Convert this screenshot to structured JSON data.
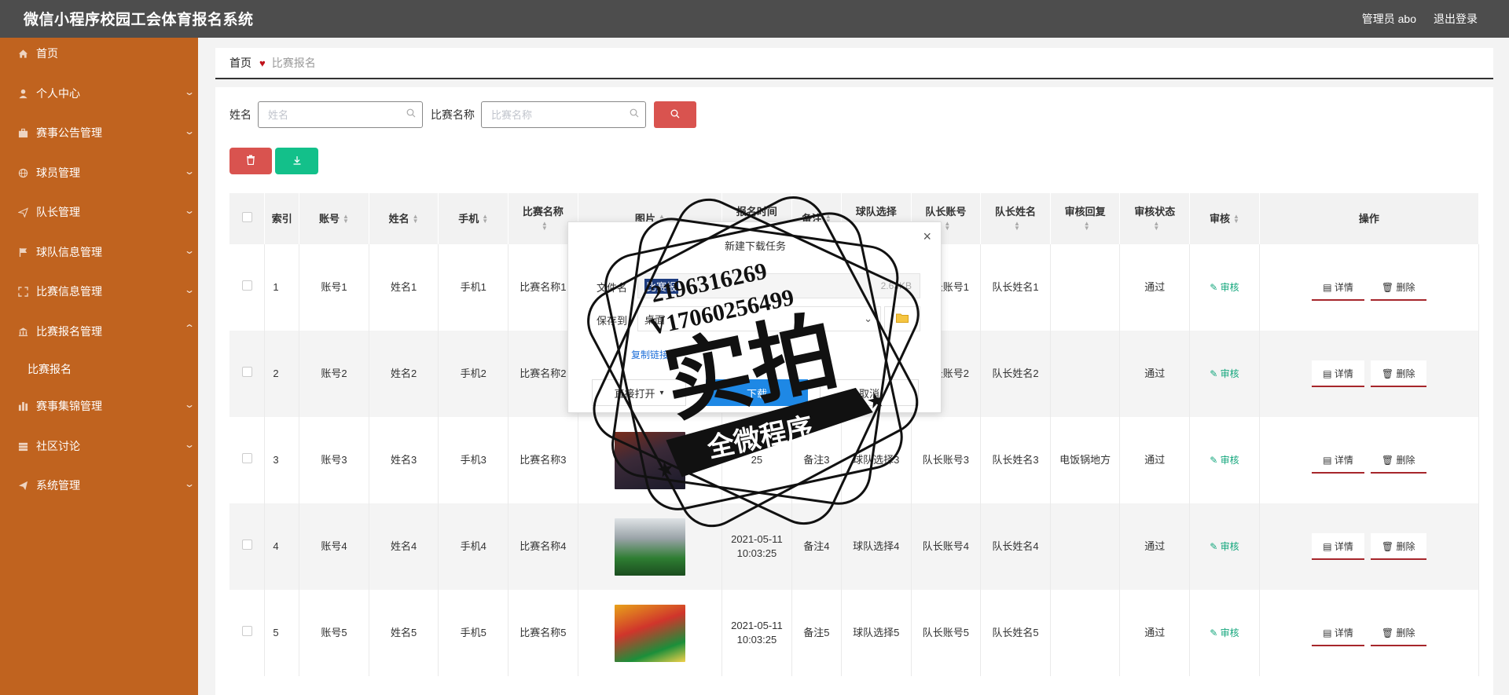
{
  "app": {
    "title": "微信小程序校园工会体育报名系统",
    "user_label": "管理员 abo",
    "logout_label": "退出登录"
  },
  "sidebar": {
    "items": [
      {
        "label": "首页",
        "icon": "home-icon"
      },
      {
        "label": "个人中心",
        "icon": "user-icon"
      },
      {
        "label": "赛事公告管理",
        "icon": "briefcase-icon"
      },
      {
        "label": "球员管理",
        "icon": "globe-icon"
      },
      {
        "label": "队长管理",
        "icon": "send-icon"
      },
      {
        "label": "球队信息管理",
        "icon": "flag-icon"
      },
      {
        "label": "比赛信息管理",
        "icon": "expand-icon"
      },
      {
        "label": "比赛报名管理",
        "icon": "bank-icon"
      },
      {
        "label": "赛事集锦管理",
        "icon": "chart-icon"
      },
      {
        "label": "社区讨论",
        "icon": "stack-icon"
      },
      {
        "label": "系统管理",
        "icon": "plane-icon"
      }
    ],
    "subitem": "比赛报名"
  },
  "breadcrumb": {
    "home": "首页",
    "current": "比赛报名"
  },
  "search": {
    "name_label": "姓名",
    "name_placeholder": "姓名",
    "match_label": "比赛名称",
    "match_placeholder": "比赛名称"
  },
  "table": {
    "headers": [
      "索引",
      "账号",
      "姓名",
      "手机",
      "比赛名称",
      "图片",
      "报名时间",
      "备注",
      "球队选择",
      "队长账号",
      "队长姓名",
      "审核回复",
      "审核状态",
      "审核",
      "操作"
    ],
    "rows": [
      {
        "idx": "1",
        "account": "账号1",
        "name": "姓名1",
        "phone": "手机1",
        "match": "比赛名称1",
        "time": "",
        "remark": "",
        "team": "",
        "cap_account": "队长账号1",
        "cap_name": "队长姓名1",
        "reply": "",
        "status": "通过"
      },
      {
        "idx": "2",
        "account": "账号2",
        "name": "姓名2",
        "phone": "手机2",
        "match": "比赛名称2",
        "time": "",
        "remark": "",
        "team": "",
        "cap_account": "队长账号2",
        "cap_name": "队长姓名2",
        "reply": "",
        "status": "通过"
      },
      {
        "idx": "3",
        "account": "账号3",
        "name": "姓名3",
        "phone": "手机3",
        "match": "比赛名称3",
        "time": "25",
        "remark": "备注3",
        "team": "球队选择3",
        "cap_account": "队长账号3",
        "cap_name": "队长姓名3",
        "reply": "电饭锅地方",
        "status": "通过"
      },
      {
        "idx": "4",
        "account": "账号4",
        "name": "姓名4",
        "phone": "手机4",
        "match": "比赛名称4",
        "time": "2021-05-11 10:03:25",
        "remark": "备注4",
        "team": "球队选择4",
        "cap_account": "队长账号4",
        "cap_name": "队长姓名4",
        "reply": "",
        "status": "通过"
      },
      {
        "idx": "5",
        "account": "账号5",
        "name": "姓名5",
        "phone": "手机5",
        "match": "比赛名称5",
        "time": "2021-05-11 10:03:25",
        "remark": "备注5",
        "team": "球队选择5",
        "cap_account": "队长账号5",
        "cap_name": "队长姓名5",
        "reply": "",
        "status": "通过"
      }
    ],
    "audit_label": "审核",
    "detail_label": "详情",
    "delete_label": "删除"
  },
  "modal": {
    "title": "新建下载任务",
    "file_label": "文件名",
    "file_value": "比赛报",
    "file_size": "2.63KB",
    "save_label": "保存到",
    "save_value": "桌面",
    "copy_link": "复制链接",
    "open_btn": "直接打开",
    "download_btn": "下载",
    "cancel_btn": "取消"
  },
  "watermark": {
    "line1": "2196316269",
    "line2": "V17060256499",
    "main": "实拍",
    "banner": "全微程序"
  },
  "colors": {
    "topbar": "#4d4d4d",
    "sidebar": "#c0631f",
    "danger": "#d9534f",
    "success": "#13c08a",
    "audit": "#13a67c",
    "underline": "#a6262b"
  }
}
